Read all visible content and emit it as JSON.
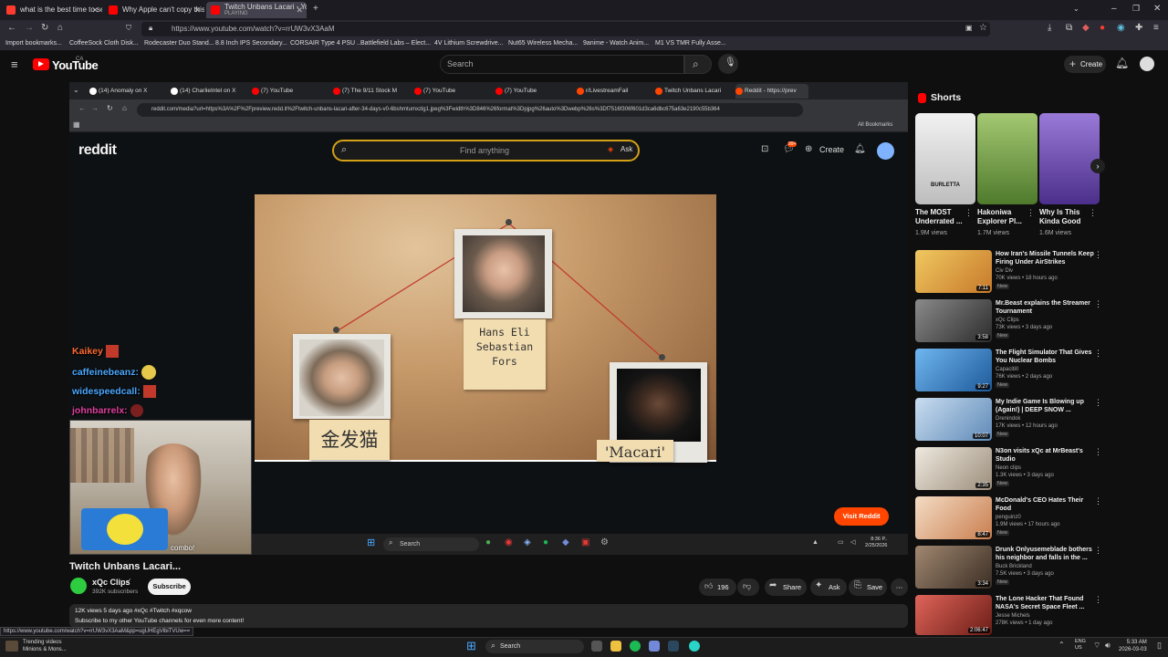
{
  "browser": {
    "tabs": [
      {
        "label": "what is the best time to see th",
        "color": "#ff3b30"
      },
      {
        "label": "Why Apple can't copy this Sams",
        "color": "#ff0000"
      },
      {
        "label": "Twitch Unbans Lacari - YouTub",
        "sublabel": "PLAYING",
        "color": "#ff0000"
      }
    ],
    "url": "https://www.youtube.com/watch?v=rrUW3vX3AaM",
    "bookmarks": [
      "Import bookmarks...",
      "CoffeeSock Cloth Disk...",
      "Rodecaster Duo Stand...",
      "8.8 Inch IPS Secondary...",
      "CORSAIR Type 4 PSU ...",
      "Battlefield Labs – Elect...",
      "4V Lithium Screwdrive...",
      "Nut65 Wireless Mecha...",
      "9anime - Watch Anim...",
      "M1 VS TMR Fully Asse..."
    ]
  },
  "youtube": {
    "logo": "YouTube",
    "logo_region": "CA",
    "search_placeholder": "Search",
    "create_label": "Create"
  },
  "inner": {
    "tabs": [
      "(14) Anomaly on X",
      "(14) CharlieIntel on X",
      "(7) YouTube",
      "(7) The 9/11 Stock M",
      "(7) YouTube",
      "(7) YouTube",
      "r/LivestreamFail",
      "Twitch Unbans Lacari",
      "Reddit - https://prev"
    ],
    "url": "reddit.com/media?url=https%3A%2F%2Fpreview.redd.it%2Ftwitch-unbans-lacari-after-34-days-v0-6bshmtumxzlg1.jpeg%3Fwidth%3D846%26format%3Dpjpg%26auto%3Dwebp%26s%3Df7516f306f601d3ca6dbc675a63e2190c55b364",
    "all_bookmarks": "All Bookmarks",
    "reddit_logo": "reddit",
    "reddit_search": "Find anything",
    "reddit_ask": "Ask",
    "reddit_create": "Create",
    "reddit_badge": "99+",
    "visit_reddit": "Visit Reddit",
    "win_search": "Search",
    "clock_time": "8:36 P..",
    "clock_date": "2/25/2026"
  },
  "board": {
    "note_center": [
      "Hans Eli",
      "Sebastian",
      "Fors"
    ],
    "note_left": "金发猫",
    "note_right": "'Macari'"
  },
  "chat": [
    {
      "user": "Kaikey",
      "color": "#ff6b35"
    },
    {
      "user": "caffeinebeanz:",
      "color": "#4aa8ff"
    },
    {
      "user": "widespeedcall:",
      "color": "#4aa8ff"
    },
    {
      "user": "johnbarrelx:",
      "color": "#e040a0"
    }
  ],
  "overlay": {
    "combo": "combo!"
  },
  "video": {
    "title": "Twitch Unbans Lacari...",
    "channel": "xQc Clips",
    "subs": "392K subscribers",
    "subscribe": "Subscribe",
    "likes": "196",
    "share": "Share",
    "ask": "Ask",
    "save": "Save",
    "meta": "12K views  5 days ago  #xQc #Twitch #xqcow",
    "description": "Subscribe to my other YouTube channels for even more content!",
    "status_url": "https://www.youtube.com/watch?v=rrUW3vX3AaM&pp=ugUHEgVlbiTVUw=="
  },
  "shorts": {
    "heading": "Shorts",
    "items": [
      {
        "title": "The MOST Underrated ...",
        "views": "1.9M views",
        "color": "#e8e8e8",
        "thumb_label": "BURLETTA"
      },
      {
        "title": "Hakoniwa Explorer Pl...",
        "views": "1.7M views",
        "color": "#6aa84f",
        "thumb_label": ""
      },
      {
        "title": "Why Is This Kinda Good",
        "views": "1.6M views",
        "color": "#7b5ec8",
        "thumb_label": ""
      }
    ]
  },
  "recommended": [
    {
      "title": "How Iran's Missile Tunnels Keep Firing Under AirStrikes",
      "channel": "Civ Div",
      "views": "70K views • 18 hours ago",
      "new": "New",
      "dur": "7:11",
      "color": "#d9a441"
    },
    {
      "title": "Mr.Beast explains the Streamer Tournament",
      "channel": "xQc Clips",
      "views": "73K views • 3 days ago",
      "new": "New",
      "dur": "3:58",
      "color": "#555555"
    },
    {
      "title": "The Flight Simulator That Gives You Nuclear Bombs",
      "channel": "CapacitiII",
      "views": "76K views • 2 days ago",
      "new": "New",
      "dur": "9:27",
      "color": "#3a86c8"
    },
    {
      "title": "My Indie Game Is Blowing up (Again!) | DEEP SNOW ...",
      "channel": "Drenindok",
      "views": "17K views • 12 hours ago",
      "new": "New",
      "dur": "10:07",
      "color": "#8fb3d9"
    },
    {
      "title": "N3on visits xQc at MrBeast's Studio",
      "channel": "Neon clips",
      "views": "1.3K views • 3 days ago",
      "new": "New",
      "dur": "2:35",
      "color": "#d8d2c8"
    },
    {
      "title": "McDonald's CEO Hates Their Food",
      "channel": "penguinz0",
      "views": "1.9M views • 17 hours ago",
      "new": "New",
      "dur": "8:47",
      "color": "#e8c3a0"
    },
    {
      "title": "Drunk Onlyusemeblade bothers his neighbor and falls in the ...",
      "channel": "Buck Brickland",
      "views": "7.5K views • 3 days ago",
      "new": "New",
      "dur": "3:34",
      "color": "#6b5a4a"
    },
    {
      "title": "The Lone Hacker That Found NASA's Secret Space Fleet ...",
      "channel": "Jesse Michels",
      "views": "278K views • 1 day ago",
      "new": "",
      "dur": "2:06:47",
      "color": "#c0392b"
    }
  ],
  "taskbar": {
    "trending_title": "Trending videos",
    "trending_sub": "Minions & Mons...",
    "search": "Search",
    "lang_1": "ENG",
    "lang_2": "US",
    "time": "5:33 AM",
    "date": "2026-03-03"
  }
}
